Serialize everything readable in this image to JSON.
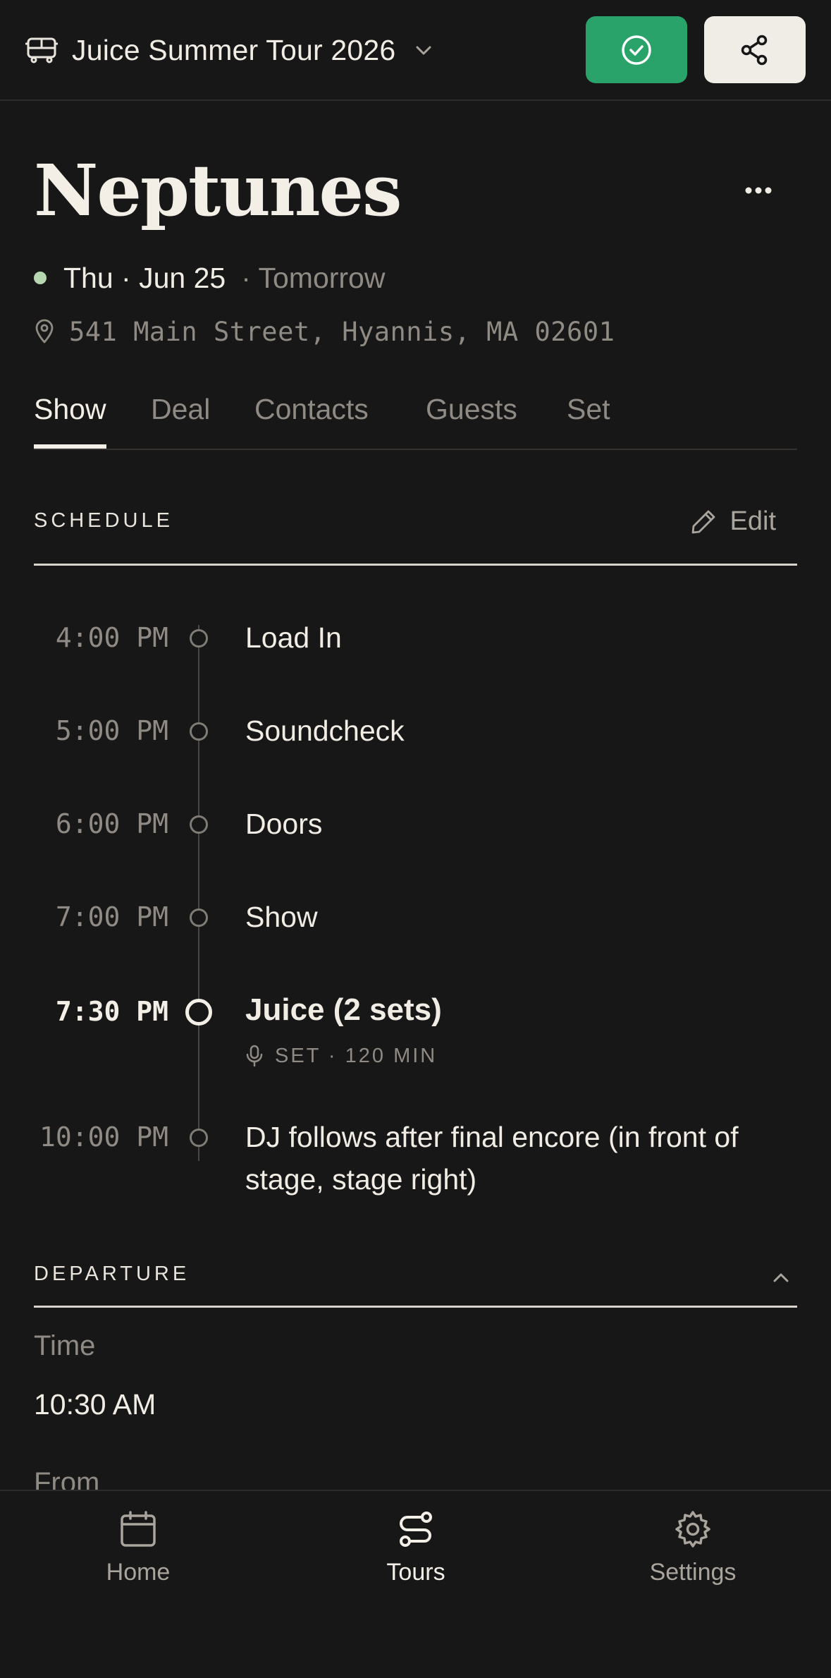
{
  "topbar": {
    "tour_title": "Juice Summer Tour 2026",
    "bus_icon": "bus-icon",
    "chevron_icon": "chevron-down-icon",
    "confirm_icon": "check-circle-icon",
    "share_icon": "share-icon",
    "confirm_color": "#2aa36a"
  },
  "header": {
    "venue_name": "Neptunes",
    "more_icon": "more-horizontal-icon",
    "date": "Thu · Jun 25",
    "relative": "· Tomorrow",
    "address": "541 Main Street, Hyannis, MA 02601",
    "status_color": "#b7d7b0"
  },
  "tabs": [
    {
      "label": "Show",
      "active": true
    },
    {
      "label": "Deal"
    },
    {
      "label": "Contacts"
    },
    {
      "label": "Guests"
    },
    {
      "label": "Set"
    }
  ],
  "schedule": {
    "label": "SCHEDULE",
    "edit_label": "Edit",
    "items": [
      {
        "time": "4:00 PM",
        "title": "Load In"
      },
      {
        "time": "5:00 PM",
        "title": "Soundcheck"
      },
      {
        "time": "6:00 PM",
        "title": "Doors"
      },
      {
        "time": "7:00 PM",
        "title": "Show"
      },
      {
        "time": "7:30 PM",
        "title": "Juice (2 sets)",
        "meta": "SET · 120 MIN",
        "current": true
      },
      {
        "time": "10:00 PM",
        "title": "DJ follows after final encore (in front of stage, stage right)"
      }
    ]
  },
  "departure": {
    "label": "DEPARTURE",
    "time_label": "Time",
    "time_value": "10:30 AM",
    "from_label": "From"
  },
  "nav": [
    {
      "label": "Home",
      "icon": "calendar-icon"
    },
    {
      "label": "Tours",
      "icon": "route-icon",
      "active": true
    },
    {
      "label": "Settings",
      "icon": "gear-icon"
    }
  ]
}
